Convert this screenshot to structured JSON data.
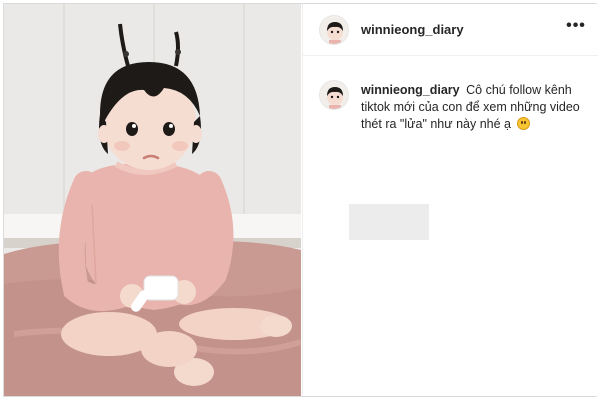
{
  "post": {
    "username": "winnieong_diary",
    "more_menu_label": "•••",
    "photo_alt": "Baby girl in pink romper sitting on a fluffy rug holding a small white brush",
    "caption": {
      "username": "winnieong_diary",
      "text": "Cô chú follow kênh tiktok mới của con để xem những video thét ra \"lửa\" như này nhé ạ",
      "emoji": "grinning-face-emoji"
    }
  },
  "colors": {
    "border": "#dbdbdb",
    "text": "#262626",
    "placeholder": "#ececec",
    "romper": "#e8b4ad",
    "rug": "#c99a92"
  }
}
